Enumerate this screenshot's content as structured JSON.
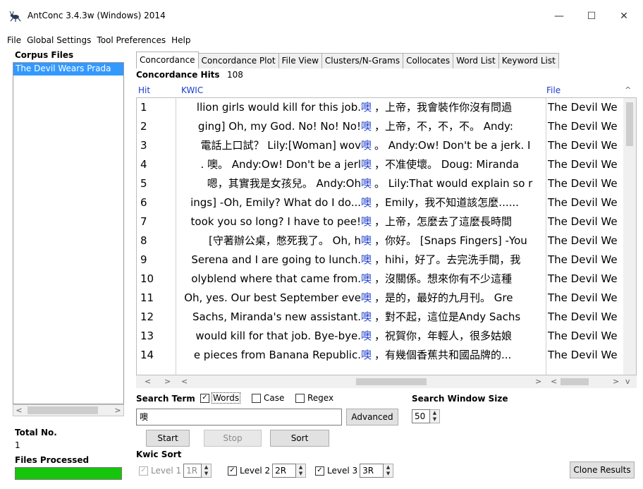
{
  "window": {
    "title": "AntConc 3.4.3w (Windows) 2014",
    "minimize": "—",
    "maximize": "☐",
    "close": "✕"
  },
  "menu": [
    "File",
    "Global Settings",
    "Tool Preferences",
    "Help"
  ],
  "left_panel": {
    "corpus_files_label": "Corpus Files",
    "files": [
      "The Devil Wears Prada"
    ],
    "total_label": "Total No.",
    "total_value": "1",
    "files_processed_label": "Files Processed",
    "progress": 1.0,
    "progress_color": "#16c60c"
  },
  "tabs": [
    "Concordance",
    "Concordance Plot",
    "File View",
    "Clusters/N-Grams",
    "Collocates",
    "Word List",
    "Keyword List"
  ],
  "active_tab": 0,
  "concordance": {
    "hits_label": "Concordance Hits",
    "hits_count": "108",
    "col_hit": "Hit",
    "col_kwic": "KWIC",
    "col_file": "File",
    "keyword": "噢",
    "rows": [
      {
        "hit": "1",
        "left": "llion girls would kill for this job.",
        "right": "，上帝，我會裝作你沒有問過",
        "file": "The Devil We"
      },
      {
        "hit": "2",
        "left": "ging] Oh, my God. No! No! No!",
        "right": "，上帝，不，不，不。 Andy:",
        "file": "The Devil We"
      },
      {
        "hit": "3",
        "left": "電話上口試？ Lily:[Woman] wov",
        "right": "。 Andy:Ow! Don't be a jerk. I",
        "file": "The Devil We"
      },
      {
        "hit": "4",
        "left": ". 噢。 Andy:Ow! Don't be a jerl",
        "right": "，不准使壞。 Doug: Miranda",
        "file": "The Devil We"
      },
      {
        "hit": "5",
        "left": "嗯，其實我是女孩兒。 Andy:Oh",
        "right": "。 Lily:That would explain so r",
        "file": "The Devil We"
      },
      {
        "hit": "6",
        "left": "ings] -Oh, Emily? What do I do...",
        "right": "，Emily，我不知道該怎麼......",
        "file": "The Devil We"
      },
      {
        "hit": "7",
        "left": "took you so long? I have to pee!",
        "right": "，上帝，怎麼去了這麼長時間",
        "file": "The Devil We"
      },
      {
        "hit": "8",
        "left": "[守著辦公桌，憋死我了。 Oh, h",
        "right": "，你好。 [Snaps Fingers] -You",
        "file": "The Devil We"
      },
      {
        "hit": "9",
        "left": "Serena and I are going to lunch.",
        "right": "，hihi，好了。去完洗手間，我",
        "file": "The Devil We"
      },
      {
        "hit": "10",
        "left": "olyblend where that came from.",
        "right": "，沒關係。想來你有不少這種",
        "file": "The Devil We"
      },
      {
        "hit": "11",
        "left": "Oh, yes. Our best September eve",
        "right": "，是的，最好的九月刊。 Gre",
        "file": "The Devil We"
      },
      {
        "hit": "12",
        "left": "Sachs, Miranda's new assistant.",
        "right": "，對不起，這位是Andy Sachs",
        "file": "The Devil We"
      },
      {
        "hit": "13",
        "left": "would kill for that job. Bye-bye.",
        "right": "，祝賀你，年輕人，很多姑娘",
        "file": "The Devil We"
      },
      {
        "hit": "14",
        "left": "e pieces from Banana Republic.",
        "right": "，有幾個香蕉共和國品牌的...",
        "file": "The Devil We"
      }
    ]
  },
  "search": {
    "term_label": "Search Term",
    "words_label": "Words",
    "case_label": "Case",
    "regex_label": "Regex",
    "term_value": "噢",
    "advanced_label": "Advanced",
    "window_size_label": "Search Window Size",
    "window_size_value": "50",
    "start_label": "Start",
    "stop_label": "Stop",
    "sort_label": "Sort"
  },
  "kwic_sort": {
    "label": "Kwic Sort",
    "level1_label": "Level 1",
    "level1_value": "1R",
    "level2_label": "Level 2",
    "level2_value": "2R",
    "level3_label": "Level 3",
    "level3_value": "3R",
    "clone_label": "Clone Results"
  }
}
